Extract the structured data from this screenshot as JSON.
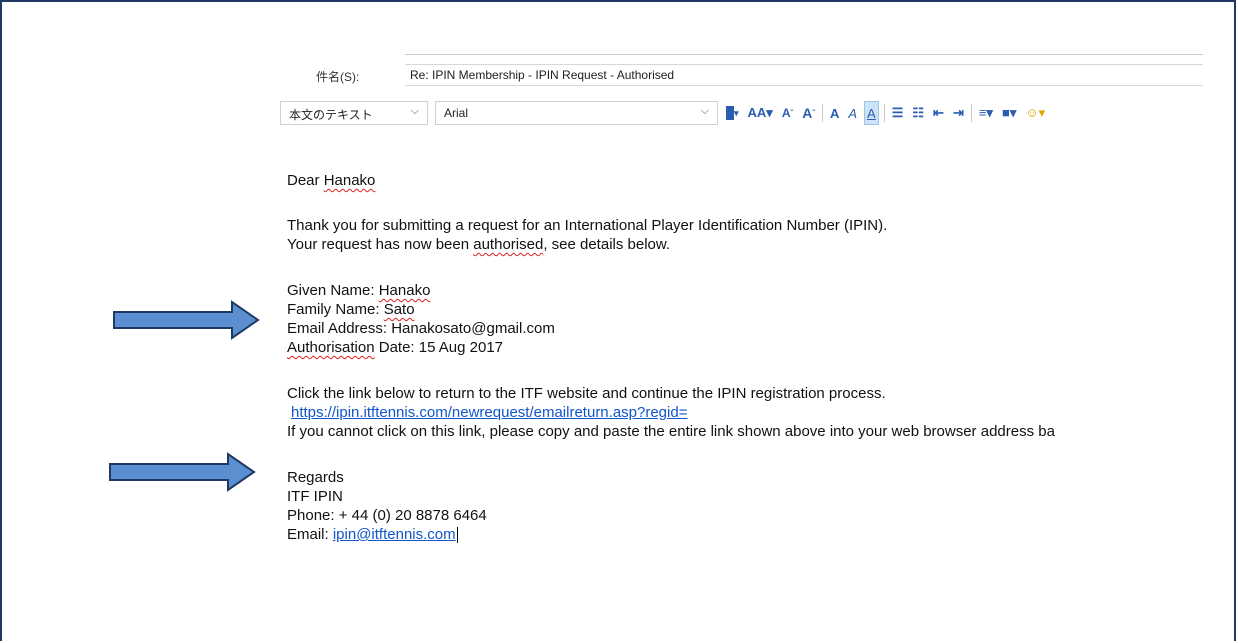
{
  "subject": {
    "label": "件名(S):",
    "value": "Re: IPIN Membership - IPIN Request - Authorised"
  },
  "toolbar": {
    "style_value": "本文のテキスト",
    "font_value": "Arial",
    "grow_font_label": "A",
    "shrink_font_label": "A",
    "bold_label": "A",
    "italic_label": "A",
    "underline_label": "A"
  },
  "email": {
    "greeting_prefix": "Dear ",
    "greeting_name": "Hanako",
    "intro_line1": "Thank you for submitting a request for an International Player Identification Number (IPIN).",
    "intro_line2_prefix": "Your request has now been ",
    "intro_line2_word": "authorised",
    "intro_line2_suffix": ", see details below.",
    "given_name_label": "Given Name: ",
    "given_name": "Hanako",
    "family_name_label": "Family Name: ",
    "family_name": "Sato",
    "email_line": "Email Address: Hanakosato@gmail.com",
    "auth_date_word": "Authorisation",
    "auth_date_rest": " Date: 15 Aug 2017",
    "click_line": "Click the link below to return to the ITF website and continue the IPIN registration process.",
    "link": "https://ipin.itftennis.com/newrequest/emailreturn.asp?regid=",
    "fallback_line": "If you cannot click on this link, please copy and paste the entire link shown above into your web browser address ba",
    "regards": "Regards",
    "sig_name": "ITF IPIN",
    "phone": "Phone: + 44 (0) 20 8878 6464",
    "email_label": "Email: ",
    "email_link": "ipin@itftennis.com"
  },
  "colors": {
    "arrow_fill": "#5b8fd1",
    "arrow_stroke": "#1f3864",
    "frame": "#1f3864",
    "link": "#1155cc"
  }
}
